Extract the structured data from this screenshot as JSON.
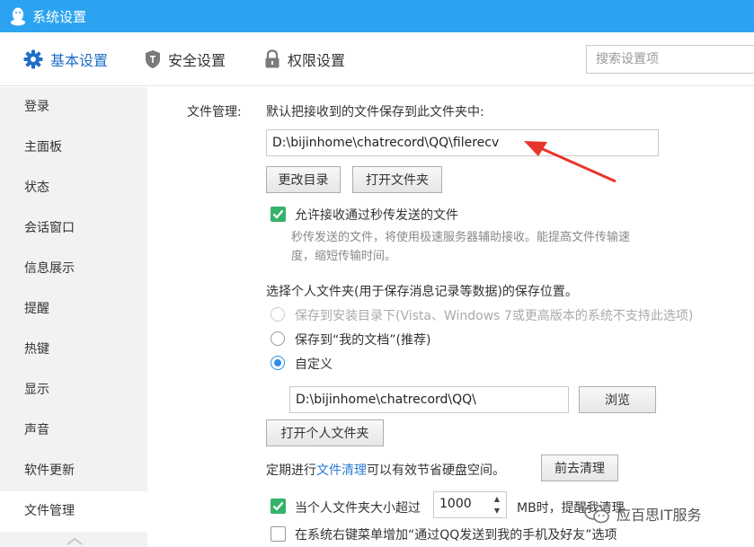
{
  "window": {
    "title": "系统设置"
  },
  "tabs": [
    {
      "label": "基本设置",
      "icon": "gear-icon"
    },
    {
      "label": "安全设置",
      "icon": "shield-icon"
    },
    {
      "label": "权限设置",
      "icon": "lock-icon"
    }
  ],
  "search": {
    "placeholder": "搜索设置项"
  },
  "sidebar": {
    "items": [
      {
        "label": "登录"
      },
      {
        "label": "主面板"
      },
      {
        "label": "状态"
      },
      {
        "label": "会话窗口"
      },
      {
        "label": "信息展示"
      },
      {
        "label": "提醒"
      },
      {
        "label": "热键"
      },
      {
        "label": "显示"
      },
      {
        "label": "声音"
      },
      {
        "label": "软件更新"
      },
      {
        "label": "文件管理"
      }
    ],
    "active": "文件管理"
  },
  "file_management": {
    "section_label": "文件管理:",
    "save_desc": "默认把接收到的文件保存到此文件夹中:",
    "save_path": "D:\\bijinhome\\chatrecord\\QQ\\filerecv",
    "change_dir_btn": "更改目录",
    "open_folder_btn": "打开文件夹",
    "allow_instant_label": "允许接收通过秒传发送的文件",
    "allow_instant_checked": true,
    "allow_instant_hint_1": "秒传发送的文件，将使用极速服务器辅助接收。能提高文件传输速",
    "allow_instant_hint_2": "度，缩短传输时间。",
    "personal_folder_desc": "选择个人文件夹(用于保存消息记录等数据)的保存位置。",
    "radio_install_dir": "保存到安装目录下(Vista、Windows 7或更高版本的系统不支持此选项)",
    "radio_my_docs": "保存到“我的文档”(推荐)",
    "radio_custom": "自定义",
    "selected_option": "自定义",
    "custom_path": "D:\\bijinhome\\chatrecord\\QQ\\",
    "browse_btn": "浏览",
    "open_personal_btn": "打开个人文件夹",
    "cleanup_prefix": "定期进行",
    "cleanup_link": "文件清理",
    "cleanup_suffix": "可以有效节省硬盘空间。",
    "cleanup_btn": "前去清理",
    "size_limit_prefix": "当个人文件夹大小超过",
    "size_limit_value": "1000",
    "size_limit_suffix": "MB时，提醒我清理",
    "size_limit_checked": true,
    "context_menu_label": "在系统右键菜单增加“通过QQ发送到我的手机及好友”选项",
    "context_menu_checked": false
  },
  "watermark": {
    "text": "应百思IT服务"
  },
  "colors": {
    "titlebar": "#2ca3f0",
    "accent": "#1f6fc6",
    "checkbox_on": "#35b36b",
    "radio_on": "#2b8fe8",
    "annotation_arrow": "#e8352c"
  }
}
